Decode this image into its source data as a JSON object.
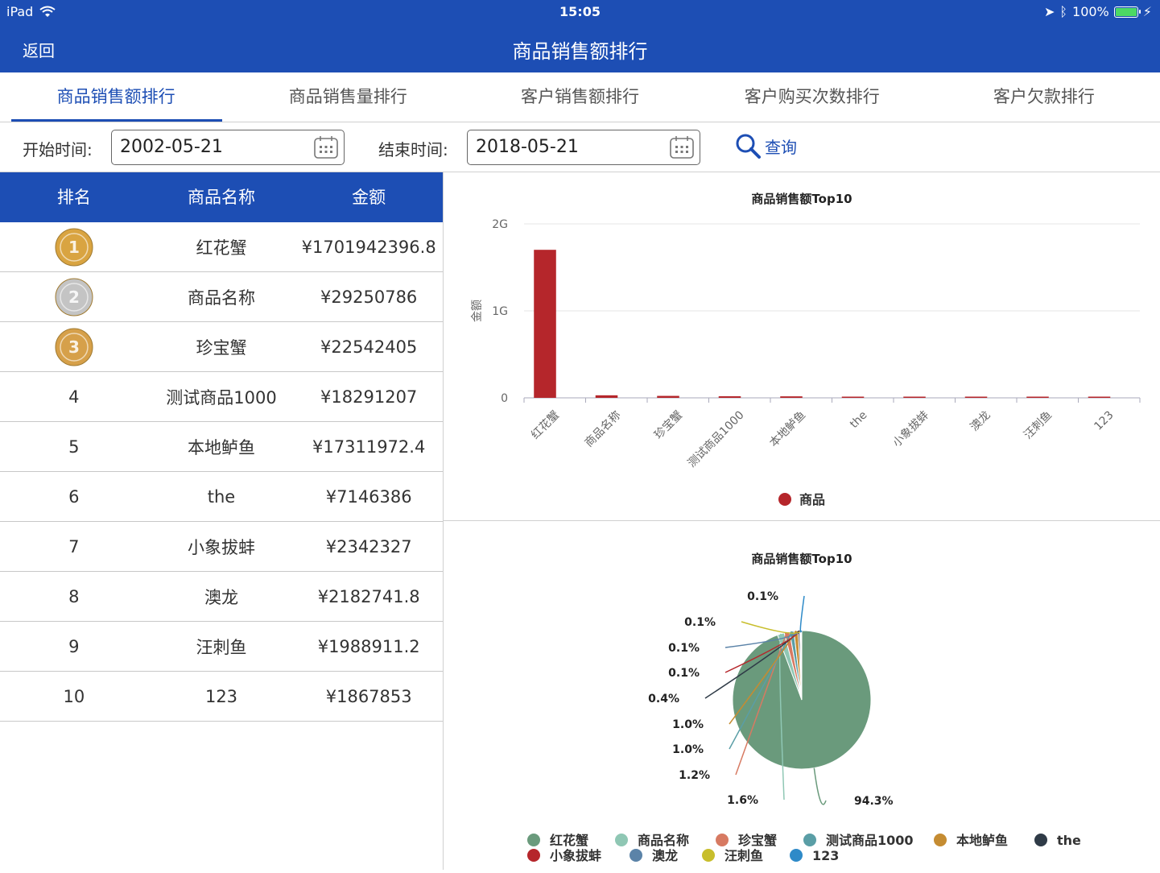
{
  "status": {
    "device": "iPad",
    "time": "15:05",
    "battery": "100%",
    "battery_level": 1.0
  },
  "nav": {
    "back_label": "返回",
    "title": "商品销售额排行"
  },
  "tabs": [
    {
      "label": "商品销售额排行",
      "active": true
    },
    {
      "label": "商品销售量排行",
      "active": false
    },
    {
      "label": "客户销售额排行",
      "active": false
    },
    {
      "label": "客户购买次数排行",
      "active": false
    },
    {
      "label": "客户欠款排行",
      "active": false
    }
  ],
  "filter": {
    "start_label": "开始时间:",
    "start_value": "2002-05-21",
    "end_label": "结束时间:",
    "end_value": "2018-05-21",
    "query_label": "查询"
  },
  "table": {
    "headers": [
      "排名",
      "商品名称",
      "金额"
    ],
    "rows": [
      {
        "rank": "1",
        "name": "红花蟹",
        "amount": "¥1701942396.8"
      },
      {
        "rank": "2",
        "name": "商品名称",
        "amount": "¥29250786"
      },
      {
        "rank": "3",
        "name": "珍宝蟹",
        "amount": "¥22542405"
      },
      {
        "rank": "4",
        "name": "测试商品1000",
        "amount": "¥18291207"
      },
      {
        "rank": "5",
        "name": "本地鲈鱼",
        "amount": "¥17311972.4"
      },
      {
        "rank": "6",
        "name": "the",
        "amount": "¥7146386"
      },
      {
        "rank": "7",
        "name": "小象拔蚌",
        "amount": "¥2342327"
      },
      {
        "rank": "8",
        "name": "澳龙",
        "amount": "¥2182741.8"
      },
      {
        "rank": "9",
        "name": "汪刺鱼",
        "amount": "¥1988911.2"
      },
      {
        "rank": "10",
        "name": "123",
        "amount": "¥1867853"
      }
    ]
  },
  "colors": {
    "primary": "#1d4eb4",
    "bar": "#b5262b",
    "gold": "#d9a441",
    "silver": "#c4c4c4",
    "bronze": "#d6a04a"
  },
  "chart_data": [
    {
      "type": "bar",
      "title": "商品销售额Top10",
      "ylabel": "金额",
      "yticks": [
        "0",
        "1G",
        "2G"
      ],
      "ylim": [
        0,
        2000000000
      ],
      "categories": [
        "红花蟹",
        "商品名称",
        "珍宝蟹",
        "测试商品1000",
        "本地鲈鱼",
        "the",
        "小象拔蚌",
        "澳龙",
        "汪刺鱼",
        "123"
      ],
      "series": [
        {
          "name": "商品",
          "color": "#b5262b",
          "values": [
            1701942396.8,
            29250786,
            22542405,
            18291207,
            17311972.4,
            7146386,
            2342327,
            2182741.8,
            1988911.2,
            1867853
          ]
        }
      ],
      "grid": true,
      "legend": "bottom"
    },
    {
      "type": "pie",
      "title": "商品销售额Top10",
      "labels": [
        "红花蟹",
        "商品名称",
        "珍宝蟹",
        "测试商品1000",
        "本地鲈鱼",
        "the",
        "小象拔蚌",
        "澳龙",
        "汪刺鱼",
        "123"
      ],
      "values": [
        1701942396.8,
        29250786,
        22542405,
        18291207,
        17311972.4,
        7146386,
        2342327,
        2182741.8,
        1988911.2,
        1867853
      ],
      "percent_labels": [
        "94.3%",
        "1.6%",
        "1.2%",
        "1.0%",
        "1.0%",
        "0.4%",
        "0.1%",
        "0.1%",
        "0.1%",
        "0.1%"
      ],
      "colors": [
        "#6a9a7c",
        "#8fc7b4",
        "#d77a62",
        "#5a9ea6",
        "#c58c32",
        "#2f3b47",
        "#b5262b",
        "#5b83a8",
        "#c8be2c",
        "#2e8ac8"
      ],
      "legend": "bottom"
    }
  ]
}
